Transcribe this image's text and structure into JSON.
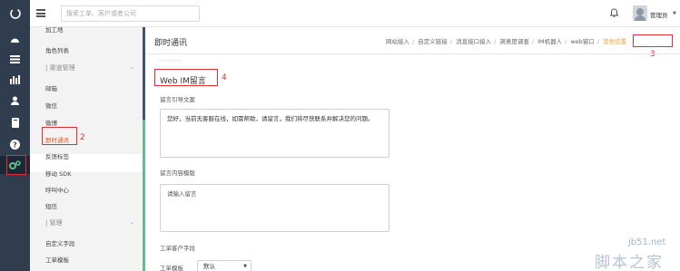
{
  "topbar": {
    "search_placeholder": "搜索工单、客户或者公司",
    "username": "管理员",
    "menu_icon": "hamburger-icon",
    "bell_icon": "bell-icon"
  },
  "rail": {
    "icons": [
      "logo-icon",
      "dashboard-icon",
      "list-icon",
      "chart-icon",
      "users-icon",
      "book-icon",
      "help-icon",
      "settings-icon"
    ]
  },
  "submenu": {
    "items_top": [
      {
        "label": "加工地",
        "group": false
      },
      {
        "label": "角色列表",
        "group": false
      },
      {
        "label": "| 渠道管理",
        "group": true
      },
      {
        "label": "邮箱",
        "group": false
      },
      {
        "label": "微信",
        "group": false
      },
      {
        "label": "微博",
        "group": false
      },
      {
        "label": "即时通讯",
        "group": false,
        "active": true
      },
      {
        "label": "反馈标签",
        "group": false
      },
      {
        "label": "移动 SDK",
        "group": false
      },
      {
        "label": "呼叫中心",
        "group": false
      },
      {
        "label": "短信",
        "group": false
      },
      {
        "label": "| 管理",
        "group": true
      },
      {
        "label": "自定义字段",
        "group": false
      },
      {
        "label": "工单模板",
        "group": false
      }
    ]
  },
  "content": {
    "page_title": "即时通讯",
    "breadcrumbs": [
      "网站接入",
      "自定义链接",
      "消息接口接入",
      "满意度调查",
      "IM机器人",
      "web窗口",
      "其他设置"
    ],
    "dots": ".........",
    "section_title": "Web IM留言",
    "guide_label": "留言引导文案",
    "guide_text": "您好，当前无客服在线，如需帮助，请留言，我们将尽快联系并解决您的问题。",
    "template_label": "留言内容模版",
    "template_text": "请输入留言",
    "fields_label": "工单客户字段",
    "select_label": "工单模板",
    "select_value": "默认"
  },
  "annotations": {
    "numbers": [
      "1",
      "2",
      "3",
      "4"
    ],
    "color": "#e03030"
  },
  "watermark": {
    "line1": "jb51.net",
    "line2": "脚本之家"
  },
  "colors": {
    "rail": "#2f3d4f",
    "active_menu": "#e8502a",
    "accent_link": "#e8a33a",
    "green_bar": "#5fbf8f"
  }
}
